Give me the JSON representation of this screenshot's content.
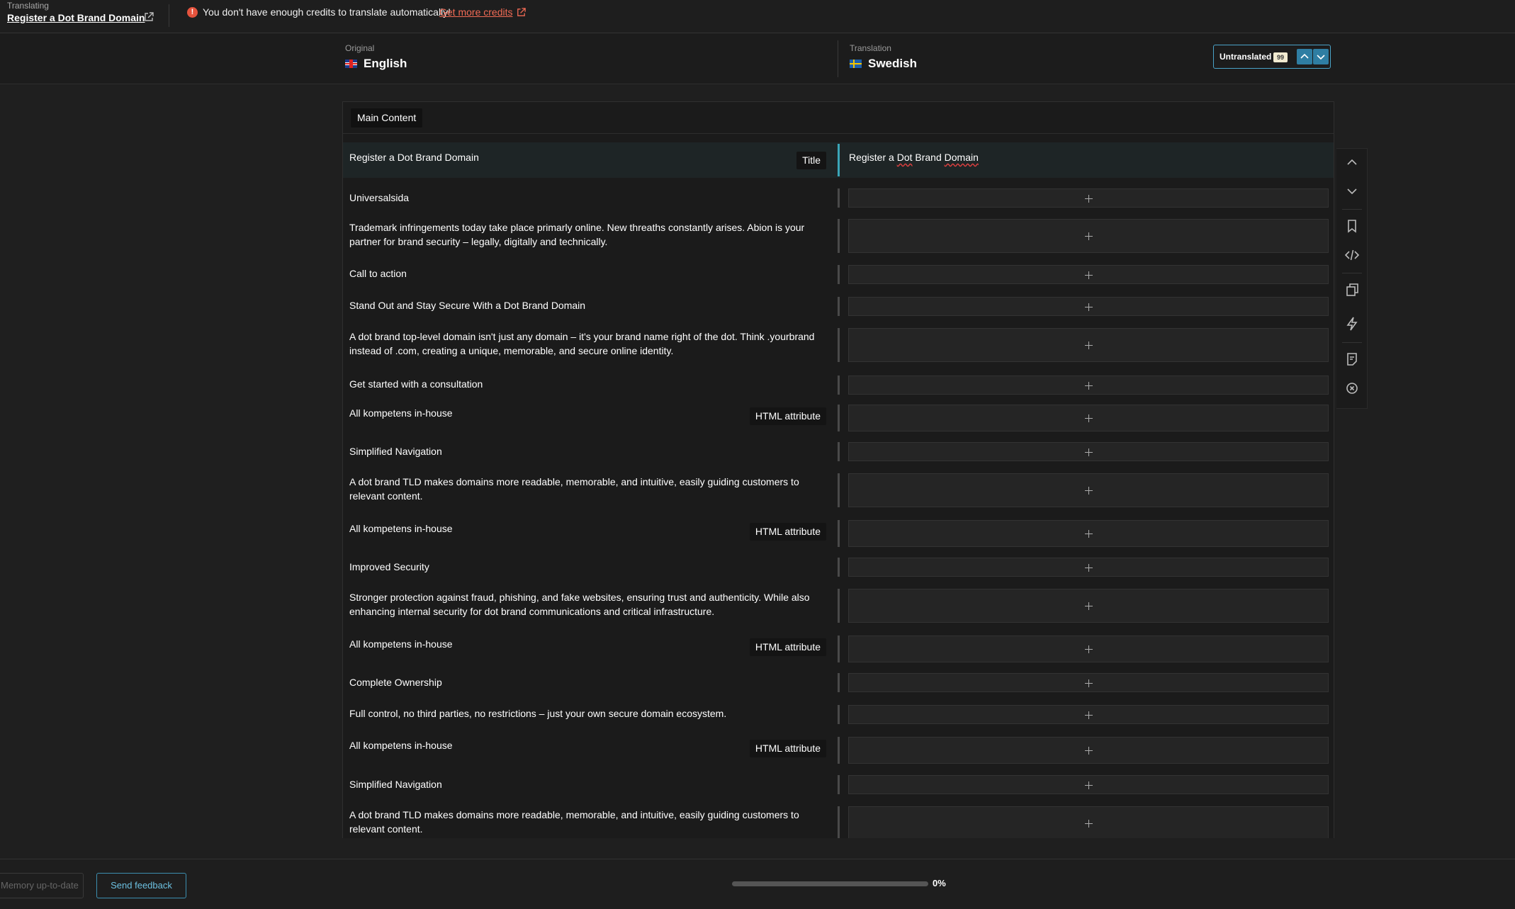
{
  "topbar": {
    "mode_label": "Translating",
    "page_title": "Register a Dot Brand Domain",
    "warning_text": "You don't have enough credits to translate automatically!",
    "credits_link": "Get more credits"
  },
  "languages": {
    "original_label": "Original",
    "original_value": "English",
    "translation_label": "Translation",
    "translation_value": "Swedish"
  },
  "filter": {
    "label": "Untranslated",
    "count": "99"
  },
  "section": {
    "label": "Main Content"
  },
  "rows": [
    {
      "source": "Register a Dot Brand Domain",
      "badge": "Title",
      "translation": "Register a Dot Brand Domain"
    },
    {
      "source": "Universalsida"
    },
    {
      "source": "Trademark infringements today take place primarly online. New threaths constantly arises. Abion is your partner for brand security – legally, digitally and technically."
    },
    {
      "source": "Call to action"
    },
    {
      "source": "Stand Out and Stay Secure With a Dot Brand Domain"
    },
    {
      "source": "A dot brand top-level domain isn't just any domain – it's your brand name right of the dot. Think .yourbrand instead of .com, creating a unique, memorable, and secure online identity."
    },
    {
      "source": "Get started with a consultation"
    },
    {
      "source": "All kompetens in-house",
      "badge": "HTML attribute"
    },
    {
      "source": "Simplified Navigation"
    },
    {
      "source": "A dot brand TLD makes domains more readable, memorable, and intuitive, easily guiding customers to relevant content."
    },
    {
      "source": "All kompetens in-house",
      "badge": "HTML attribute"
    },
    {
      "source": "Improved Security"
    },
    {
      "source": "Stronger protection against fraud, phishing, and fake websites, ensuring trust and authenticity. While also enhancing internal security for dot brand communications and critical infrastructure."
    },
    {
      "source": "All kompetens in-house",
      "badge": "HTML attribute"
    },
    {
      "source": "Complete Ownership"
    },
    {
      "source": "Full control, no third parties, no restrictions – just your own secure domain ecosystem."
    },
    {
      "source": "All kompetens in-house",
      "badge": "HTML attribute"
    },
    {
      "source": "Simplified Navigation"
    },
    {
      "source": "A dot brand TLD makes domains more readable, memorable, and intuitive, easily guiding customers to relevant content."
    }
  ],
  "toolbar_icons": [
    "chevron-up-icon",
    "chevron-down-icon",
    "bookmark-icon",
    "code-icon",
    "copy-icon",
    "lightning-icon",
    "note-icon",
    "close-circle-icon"
  ],
  "bottombar": {
    "memory_button": "Memory up-to-date",
    "feedback_button": "Send feedback",
    "progress_percent": 0,
    "progress_text": "0%"
  },
  "colors": {
    "accent": "#3aa5b8",
    "warning": "#e5533d",
    "link": "#f26b55"
  }
}
